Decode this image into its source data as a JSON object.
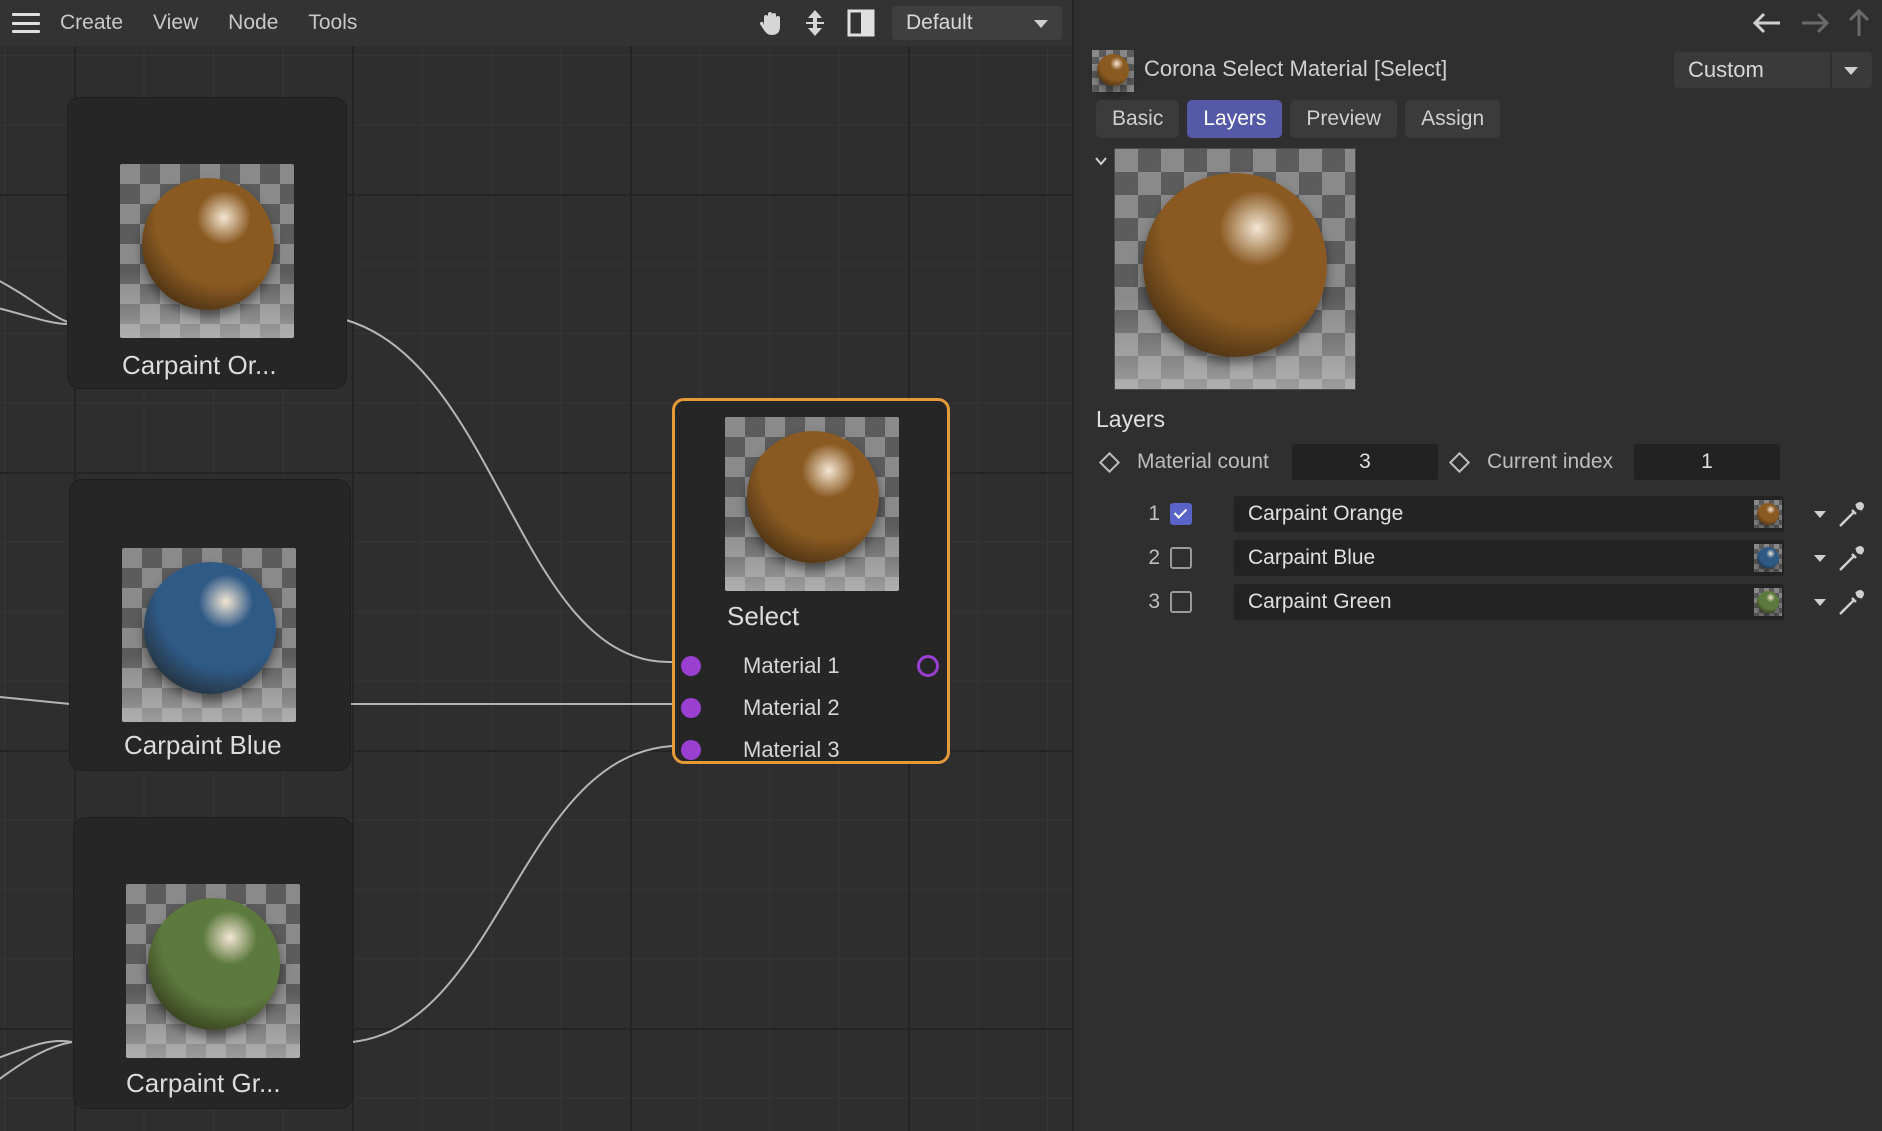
{
  "topbar": {
    "menu": [
      "Create",
      "View",
      "Node",
      "Tools"
    ],
    "layout_dropdown": "Default",
    "icons": [
      "hamburger-menu-icon",
      "hand-pan-icon",
      "move-arrows-icon",
      "panel-layout-icon",
      "chevron-down-icon"
    ]
  },
  "nodes": {
    "orange": {
      "label": "Carpaint Or...",
      "color": "#8a5a22"
    },
    "blue": {
      "label": "Carpaint Blue",
      "color": "#2f5a86"
    },
    "green": {
      "label": "Carpaint Gr...",
      "color": "#5d7a3e"
    },
    "select": {
      "label": "Select",
      "ports": [
        "Material 1",
        "Material 2",
        "Material 3"
      ],
      "border_color": "#e59a3a",
      "port_color": "#9a3fd0"
    }
  },
  "panel": {
    "title": "Corona Select Material [Select]",
    "mode": "Custom",
    "tabs": [
      {
        "label": "Basic",
        "active": false
      },
      {
        "label": "Layers",
        "active": true
      },
      {
        "label": "Preview",
        "active": false
      },
      {
        "label": "Assign",
        "active": false
      }
    ],
    "nav_icons": [
      "arrow-left-icon",
      "arrow-right-icon",
      "arrow-up-icon"
    ],
    "layers": {
      "heading": "Layers",
      "material_count_label": "Material count",
      "material_count": "3",
      "current_index_label": "Current index",
      "current_index": "1",
      "rows": [
        {
          "index": "1",
          "checked": true,
          "name": "Carpaint Orange",
          "color": "#8a5a22"
        },
        {
          "index": "2",
          "checked": false,
          "name": "Carpaint Blue",
          "color": "#2f5a86"
        },
        {
          "index": "3",
          "checked": false,
          "name": "Carpaint Green",
          "color": "#5d7a3e"
        }
      ]
    }
  },
  "colors": {
    "accent_tab": "#5459a8",
    "checkbox_checked": "#5a63c8",
    "wire": "#b5b5b5"
  }
}
